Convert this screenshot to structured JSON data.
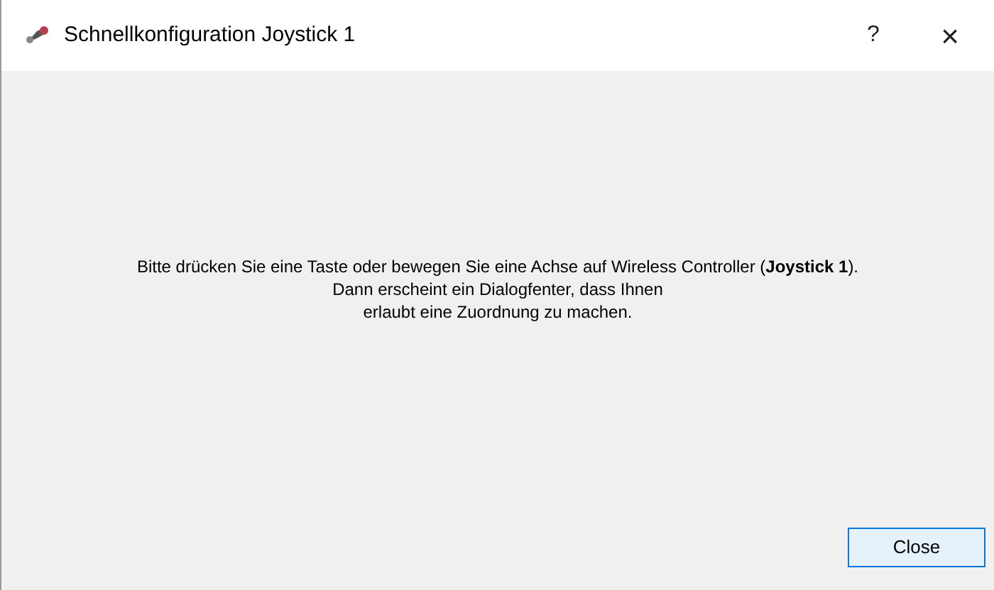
{
  "window": {
    "title": "Schnellkonfiguration Joystick 1",
    "help_button": "?",
    "close_button": "×"
  },
  "message": "Bitte drücken Sie eine Taste oder bewegen Sie eine Achse auf Wireless Controller (**Joystick 1**).\nDann erscheint ein Dialogfenter, dass Ihnen\nerlaubt eine Zuordnung zu machen.",
  "buttons": [
    "Close"
  ]
}
